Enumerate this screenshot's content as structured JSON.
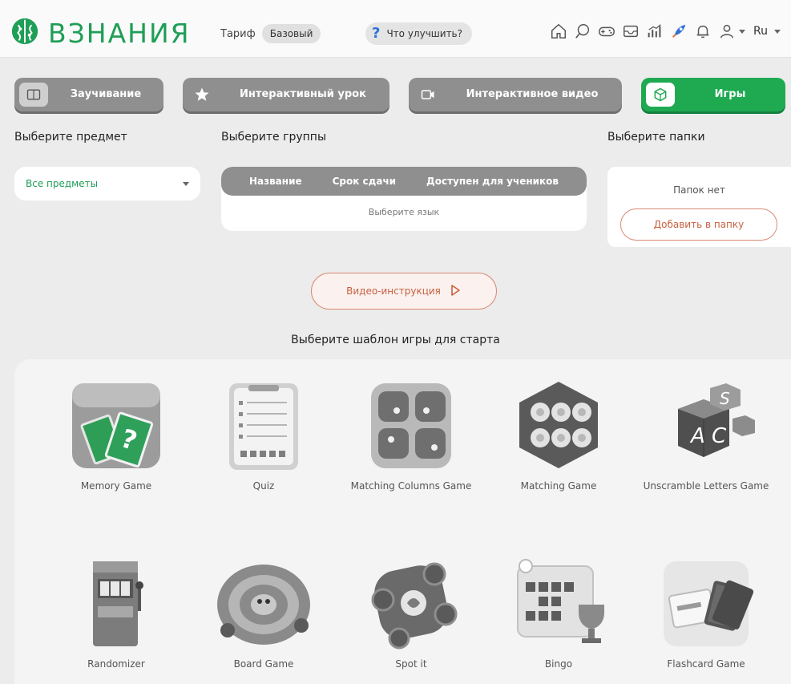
{
  "header": {
    "logo_text": "ВЗНАНИЯ",
    "tariff_label": "Тариф",
    "tariff_value": "Базовый",
    "improve_label": "Что улучшить?",
    "language": "Ru",
    "icons": [
      "home-icon",
      "search-icon",
      "gamepad-icon",
      "inbox-icon",
      "chart-icon",
      "rocket-icon",
      "bell-icon",
      "profile-icon"
    ]
  },
  "tabs": [
    {
      "label": "Заучивание",
      "icon": "book-icon"
    },
    {
      "label": "Интерактивный урок",
      "icon": "star-icon"
    },
    {
      "label": "Интерактивное видео",
      "icon": "video-icon"
    },
    {
      "label": "Игры",
      "icon": "cube-icon",
      "active": true
    }
  ],
  "subject": {
    "label": "Выберите предмет",
    "selected": "Все предметы"
  },
  "groups": {
    "label": "Выберите группы",
    "columns": [
      "Название",
      "Срок сдачи",
      "Доступен для учеников"
    ],
    "empty_text": "Выберите язык"
  },
  "folders": {
    "label": "Выберите папки",
    "empty_text": "Папок нет",
    "add_button": "Добавить в папку"
  },
  "video_instruction": "Видео-инструкция",
  "games_title": "Выберите шаблон игры для старта",
  "games": [
    {
      "name": "Memory Game",
      "icon": "memory-cards-icon"
    },
    {
      "name": "Quiz",
      "icon": "quiz-notepad-icon"
    },
    {
      "name": "Matching Columns Game",
      "icon": "matching-columns-icon"
    },
    {
      "name": "Matching Game",
      "icon": "matching-hexagon-icon"
    },
    {
      "name": "Unscramble Letters Game",
      "icon": "letter-cubes-icon"
    },
    {
      "name": "Randomizer",
      "icon": "slot-machine-icon"
    },
    {
      "name": "Board Game",
      "icon": "spiral-board-icon"
    },
    {
      "name": "Spot it",
      "icon": "spot-it-icon"
    },
    {
      "name": "Bingo",
      "icon": "bingo-trophy-icon"
    },
    {
      "name": "Flashcard Game",
      "icon": "flashcards-icon"
    }
  ],
  "colors": {
    "brand_green": "#1f9e57",
    "tab_gray": "#8f8f8f",
    "accent_orange": "#c8603f",
    "background": "#ececec"
  }
}
